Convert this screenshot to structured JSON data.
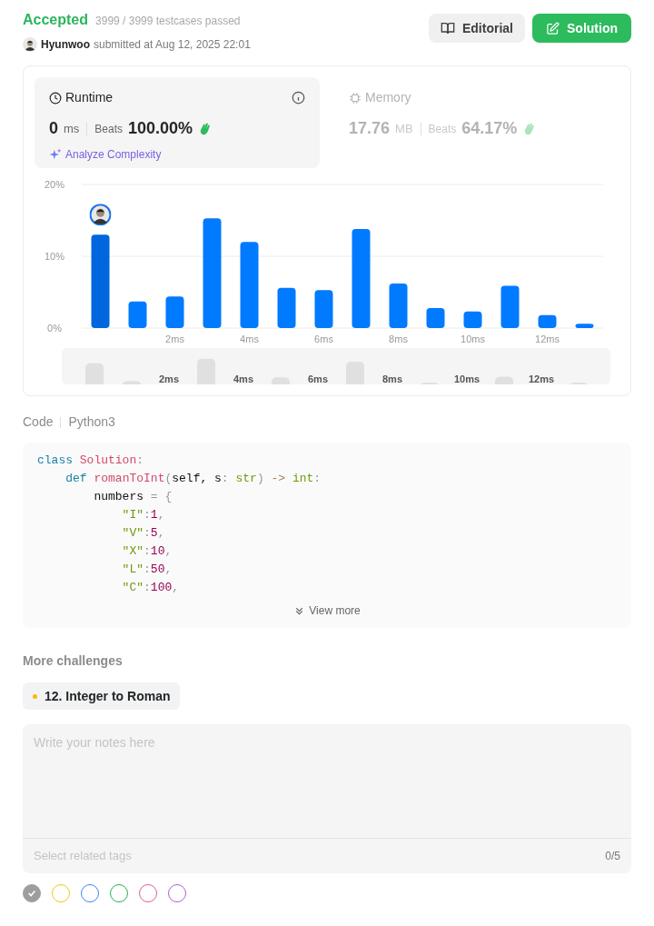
{
  "header": {
    "status": "Accepted",
    "testcases": "3999 / 3999 testcases passed",
    "user": "Hyunwoo",
    "submitted": "submitted at Aug 12, 2025 22:01",
    "buttons": [
      {
        "label": "Editorial",
        "kind": "editorial"
      },
      {
        "label": "Solution",
        "kind": "solution"
      }
    ]
  },
  "stats": [
    {
      "kind": "runtime",
      "title": "Runtime",
      "selected": true,
      "value": "0",
      "unit": "ms",
      "beats_label": "Beats",
      "beats": "100.00%",
      "action": "Analyze Complexity"
    },
    {
      "kind": "memory",
      "title": "Memory",
      "selected": false,
      "value": "17.76",
      "unit": "MB",
      "beats_label": "Beats",
      "beats": "64.17%"
    }
  ],
  "chart_data": {
    "type": "bar",
    "x": [
      0,
      1,
      2,
      3,
      4,
      5,
      6,
      7,
      8,
      9,
      10,
      11,
      12,
      13
    ],
    "xlim": [
      -0.5,
      13.5
    ],
    "series": [
      {
        "color": "#0066dd",
        "values": [
          13.0,
          null,
          null,
          null,
          null,
          null,
          null,
          null,
          null,
          null,
          null,
          null,
          null,
          null
        ]
      },
      {
        "color": "#007aff",
        "values": [
          null,
          3.7,
          4.4,
          15.3,
          12.0,
          5.6,
          5.3,
          13.8,
          6.2,
          2.8,
          2.3,
          5.9,
          1.8,
          0.6
        ]
      }
    ],
    "ylim": [
      0,
      20
    ],
    "yticks": [
      {
        "value": 0,
        "label": "0%"
      },
      {
        "value": 10,
        "label": "10%"
      },
      {
        "value": 20,
        "label": "20%"
      }
    ],
    "xticks": [
      {
        "value": 2,
        "label": "2ms"
      },
      {
        "value": 4,
        "label": "4ms"
      },
      {
        "value": 6,
        "label": "6ms"
      },
      {
        "value": 8,
        "label": "8ms"
      },
      {
        "value": 10,
        "label": "10ms"
      },
      {
        "value": 12,
        "label": "12ms"
      }
    ]
  },
  "navigator": {
    "ticks": [
      "2ms",
      "4ms",
      "6ms",
      "8ms",
      "10ms",
      "12ms"
    ]
  },
  "code": {
    "label": "Code",
    "language": "Python3",
    "view_more": "View more",
    "lines": [
      [
        {
          "text": "class ",
          "kind": "keyword"
        },
        {
          "text": "Solution",
          "kind": "name"
        },
        {
          "text": ":",
          "kind": "punct"
        }
      ],
      [
        {
          "text": "    def ",
          "kind": "keyword"
        },
        {
          "text": "romanToInt",
          "kind": "name"
        },
        {
          "text": "(",
          "kind": "punct"
        },
        {
          "text": "self, s",
          "kind": "plain"
        },
        {
          "text": ": ",
          "kind": "punct"
        },
        {
          "text": "str",
          "kind": "type"
        },
        {
          "text": ") ",
          "kind": "punct"
        },
        {
          "text": "-> ",
          "kind": "operator"
        },
        {
          "text": "int",
          "kind": "type"
        },
        {
          "text": ":",
          "kind": "punct"
        }
      ],
      [
        {
          "text": "        numbers ",
          "kind": "plain"
        },
        {
          "text": "= {",
          "kind": "punct"
        }
      ],
      [
        {
          "text": "            \"I\"",
          "kind": "string"
        },
        {
          "text": ":",
          "kind": "punct"
        },
        {
          "text": "1",
          "kind": "number"
        },
        {
          "text": ",",
          "kind": "punct"
        }
      ],
      [
        {
          "text": "            \"V\"",
          "kind": "string"
        },
        {
          "text": ":",
          "kind": "punct"
        },
        {
          "text": "5",
          "kind": "number"
        },
        {
          "text": ",",
          "kind": "punct"
        }
      ],
      [
        {
          "text": "            \"X\"",
          "kind": "string"
        },
        {
          "text": ":",
          "kind": "punct"
        },
        {
          "text": "10",
          "kind": "number"
        },
        {
          "text": ",",
          "kind": "punct"
        }
      ],
      [
        {
          "text": "            \"L\"",
          "kind": "string"
        },
        {
          "text": ":",
          "kind": "punct"
        },
        {
          "text": "50",
          "kind": "number"
        },
        {
          "text": ",",
          "kind": "punct"
        }
      ],
      [
        {
          "text": "            \"C\"",
          "kind": "string"
        },
        {
          "text": ":",
          "kind": "punct"
        },
        {
          "text": "100",
          "kind": "number"
        },
        {
          "text": ",",
          "kind": "punct"
        }
      ]
    ]
  },
  "more_challenges": {
    "title": "More challenges",
    "items": [
      {
        "label": "12. Integer to Roman",
        "color": "#ffb800"
      }
    ]
  },
  "notes": {
    "placeholder": "Write your notes here",
    "tags_placeholder": "Select related tags",
    "tag_count": "0/5"
  },
  "color_tags": [
    {
      "color": "#9e9e9e",
      "selected": true
    },
    {
      "color": "#f5c518",
      "selected": false
    },
    {
      "color": "#3b82f6",
      "selected": false
    },
    {
      "color": "#22b14c",
      "selected": false
    },
    {
      "color": "#e05a9a",
      "selected": false
    },
    {
      "color": "#b05cd6",
      "selected": false
    }
  ]
}
